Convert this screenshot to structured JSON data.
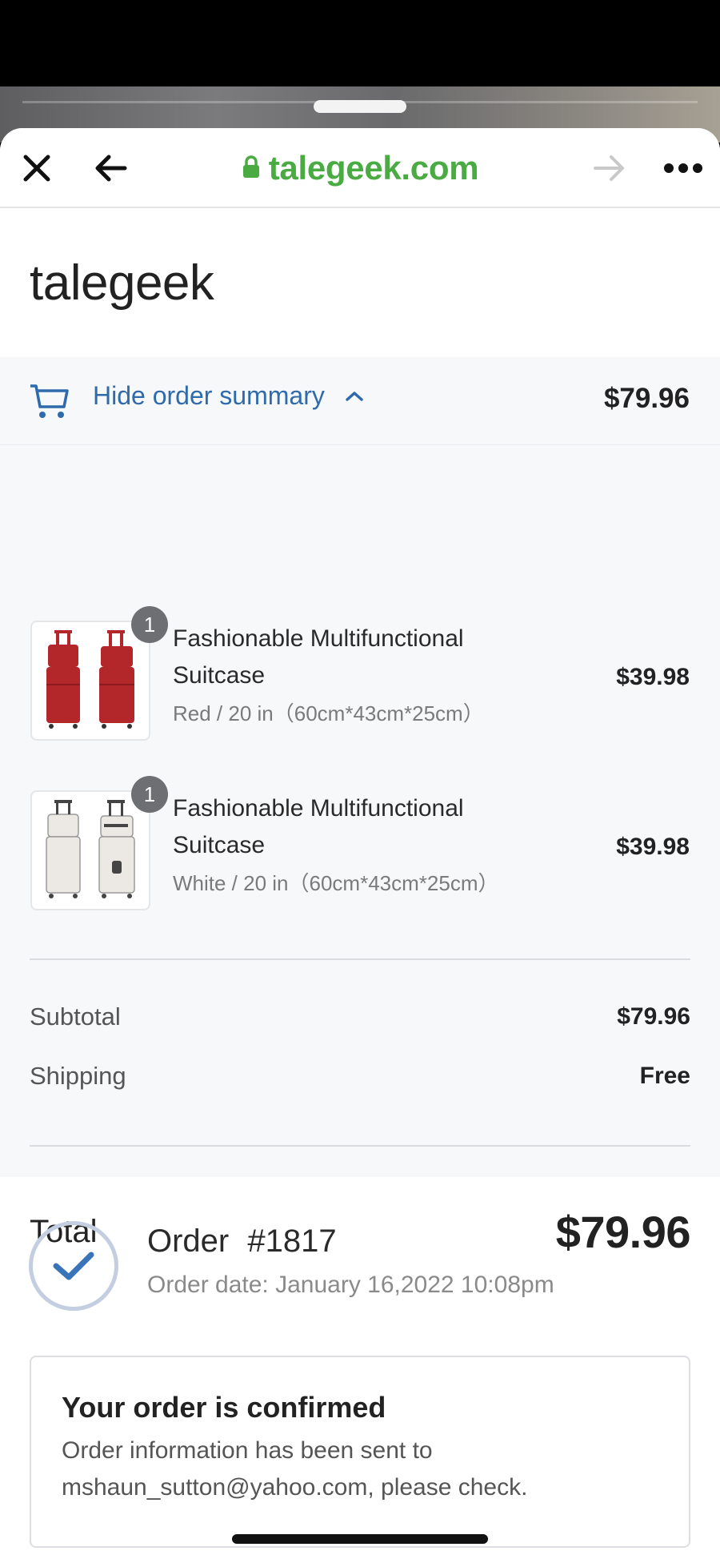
{
  "browser": {
    "url": "talegeek.com",
    "icons": [
      "close-icon",
      "back-arrow-icon",
      "lock-icon",
      "forward-arrow-icon",
      "more-icon"
    ]
  },
  "store": {
    "name": "talegeek"
  },
  "summary": {
    "toggle_label": "Hide order summary",
    "total": "$79.96",
    "items": [
      {
        "quantity": "1",
        "name": "Fashionable Multifunctional Suitcase",
        "variant": "Red / 20 in（60cm*43cm*25cm）",
        "price": "$39.98",
        "color": "#b3262a"
      },
      {
        "quantity": "1",
        "name": "Fashionable Multifunctional Suitcase",
        "variant": "White / 20 in（60cm*43cm*25cm）",
        "price": "$39.98",
        "color": "#ece9e4"
      }
    ],
    "subtotal_label": "Subtotal",
    "subtotal_value": "$79.96",
    "shipping_label": "Shipping",
    "shipping_value": "Free",
    "total_label": "Total",
    "total_value": "$79.96"
  },
  "order": {
    "label": "Order",
    "number": "#1817",
    "date_label": "Order date:",
    "date_value": "January 16,2022 10:08pm"
  },
  "confirmation": {
    "title": "Your order is confirmed",
    "message": "Order information has been sent to mshaun_sutton@yahoo.com, please check."
  },
  "colors": {
    "accent_link": "#2f6aaa",
    "url_green": "#4aab43",
    "check_blue": "#3a74b8"
  }
}
